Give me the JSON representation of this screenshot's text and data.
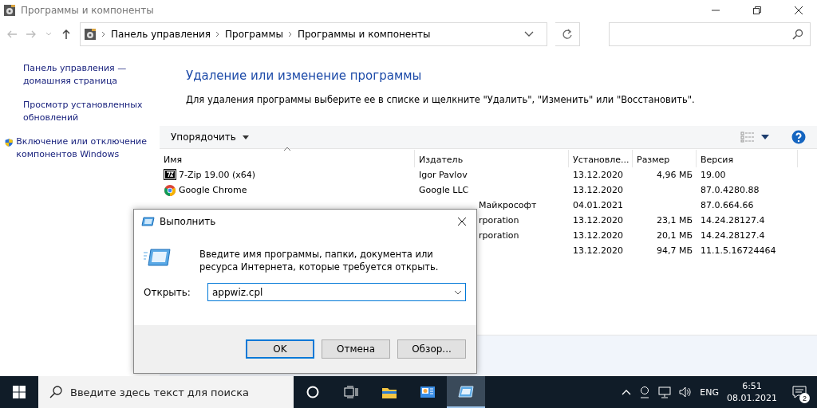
{
  "window": {
    "title": "Программы и компоненты"
  },
  "address": {
    "crumbs": [
      "Панель управления",
      "Программы",
      "Программы и компоненты"
    ]
  },
  "sidebar": {
    "links": [
      {
        "label": "Панель управления — домашняя страница",
        "shield": false
      },
      {
        "label": "Просмотр установленных обновлений",
        "shield": false
      },
      {
        "label": "Включение или отключение компонентов Windows",
        "shield": true
      }
    ]
  },
  "heading": "Удаление или изменение программы",
  "description": "Для удаления программы выберите ее в списке и щелкните \"Удалить\", \"Изменить\" или \"Восстановить\".",
  "toolbar": {
    "organize": "Упорядочить"
  },
  "table": {
    "columns": [
      {
        "label": "Имя",
        "sorted": true
      },
      {
        "label": "Издатель",
        "sorted": false
      },
      {
        "label": "Установле...",
        "sorted": false
      },
      {
        "label": "Размер",
        "sorted": false
      },
      {
        "label": "Версия",
        "sorted": false
      }
    ],
    "rows": [
      {
        "name": "7-Zip 19.00 (x64)",
        "publisher": "Igor Pavlov",
        "installed": "13.12.2020",
        "size": "4,96 МБ",
        "version": "19.00"
      },
      {
        "name": "Google Chrome",
        "publisher": "Google LLC",
        "installed": "13.12.2020",
        "version": "87.0.4280.88"
      },
      {
        "publisher": "Майкрософт",
        "installed": "04.01.2021",
        "version": "87.0.664.66"
      },
      {
        "publisher": "rporation",
        "installed": "13.12.2020",
        "size": "23,1 МБ",
        "version": "14.24.28127.4"
      },
      {
        "publisher": "rporation",
        "installed": "13.12.2020",
        "size": "20,1 МБ",
        "version": "14.24.28127.4"
      },
      {
        "installed": "13.12.2020",
        "size": "94,7 МБ",
        "version": "11.1.5.16724464"
      }
    ]
  },
  "dialog": {
    "title": "Выполнить",
    "message": "Введите имя программы, папки, документа или ресурса Интернета, которые требуется открыть.",
    "open_label": "Открыть:",
    "value": "appwiz.cpl",
    "buttons": [
      {
        "label": "OK",
        "default": true
      },
      {
        "label": "Отмена",
        "default": false
      },
      {
        "label": "Обзор...",
        "default": false
      }
    ]
  },
  "taskbar": {
    "search_placeholder": "Введите здесь текст для поиска",
    "apps": [
      {
        "active": false
      },
      {
        "active": false
      },
      {
        "active": true
      }
    ],
    "language": "ENG",
    "time": "6:51",
    "date": "08.01.2021",
    "notifications": "2"
  }
}
